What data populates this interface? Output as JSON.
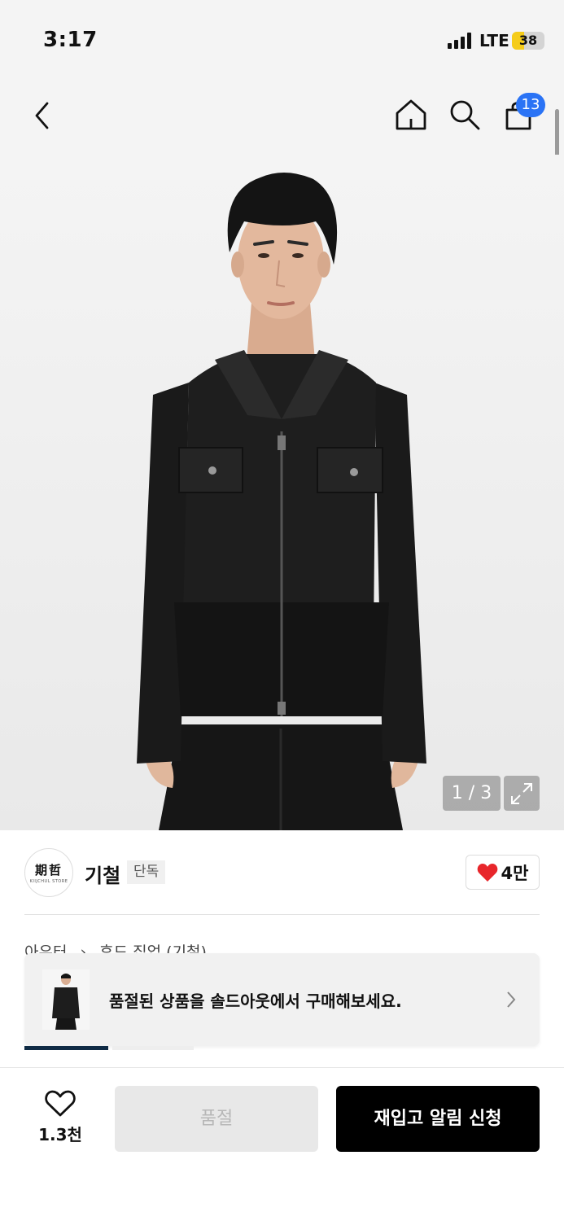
{
  "status_bar": {
    "time": "3:17",
    "network": "LTE",
    "battery": "38",
    "battery_level": 0.38
  },
  "nav": {
    "icons": [
      "chevron-left-icon",
      "home-icon",
      "search-icon",
      "shopping-bag-icon"
    ],
    "cart_count": "13"
  },
  "product_image": {
    "page": "1 / 3"
  },
  "brand": {
    "logo_main": "期哲",
    "logo_sub": "KIIJCHUL STORE",
    "name": "기철",
    "tag": "단독",
    "likes": "4만"
  },
  "breadcrumb": {
    "category": "아우터",
    "subcategory": "후드 집업 (기철)"
  },
  "toast": {
    "message": "품절된 상품을 솔드아웃에서 구매해보세요."
  },
  "bottom_bar": {
    "wish_count": "1.3천",
    "soldout_label": "품절",
    "restock_label": "재입고 알림 신청"
  },
  "colors": {
    "badge": "#2a73f5",
    "heart": "#e8262b",
    "primary_button": "#000000",
    "tab_active": "#0f2b45"
  }
}
